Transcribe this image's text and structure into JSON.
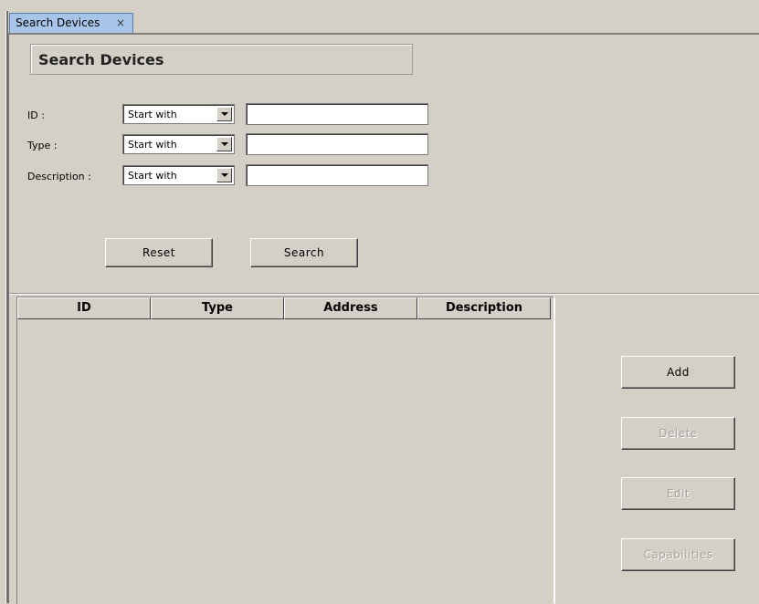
{
  "tab": {
    "label": "Search Devices",
    "close": "×"
  },
  "title": "Search Devices",
  "filters": [
    {
      "label": "ID :",
      "operator": "Start with",
      "value": ""
    },
    {
      "label": "Type :",
      "operator": "Start with",
      "value": ""
    },
    {
      "label": "Description :",
      "operator": "Start with",
      "value": ""
    }
  ],
  "buttons": {
    "reset": "Reset",
    "search": "Search",
    "add": "Add",
    "delete": "Delete",
    "edit": "Edit",
    "capabilities": "Capabilities"
  },
  "table": {
    "columns": [
      "ID",
      "Type",
      "Address",
      "Description"
    ],
    "rows": []
  }
}
